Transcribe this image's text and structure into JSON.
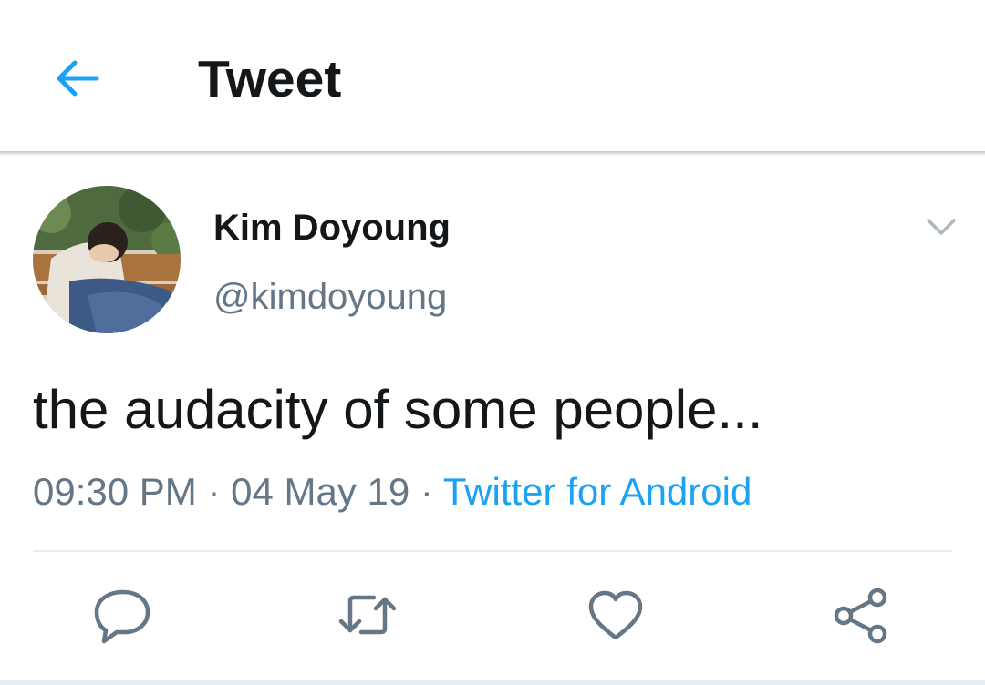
{
  "header": {
    "title": "Tweet",
    "back_icon": "arrow-left-icon",
    "accent_color": "#1da1f2"
  },
  "tweet": {
    "author_name": "Kim Doyoung",
    "author_handle": "@kimdoyoung",
    "menu_icon": "chevron-down-icon",
    "text": "the audacity of some people...",
    "time": "09:30 PM",
    "date": "04 May 19",
    "source": "Twitter for Android",
    "separator": "·"
  },
  "actions": [
    {
      "name": "reply-icon"
    },
    {
      "name": "retweet-icon"
    },
    {
      "name": "like-icon"
    },
    {
      "name": "share-icon"
    }
  ]
}
